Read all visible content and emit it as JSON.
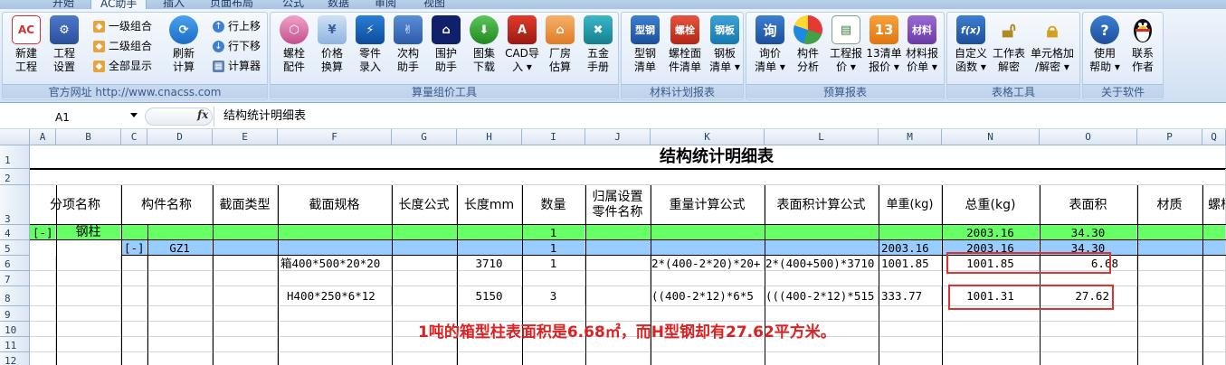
{
  "ribbon_tabs": [
    "开始",
    "AC助手",
    "插入",
    "页面布局",
    "公式",
    "数据",
    "审阅",
    "视图"
  ],
  "active_tab": "AC助手",
  "groups": {
    "site": {
      "label": "官方网址 http://www.cnacss.com",
      "new_project": "新建\n工程",
      "project_settings": "工程\n设置",
      "level1": "一级组合",
      "level2": "二级组合",
      "show_all": "全部显示",
      "refresh": "刷新\n计算",
      "row_up": "行上移",
      "row_down": "行下移",
      "calculator": "计算器"
    },
    "calc": {
      "label": "算量组价工具",
      "buttons": [
        "螺栓\n配件",
        "价格\n换算",
        "零件\n录入",
        "次构\n助手",
        "围护\n助手",
        "图集\n下载",
        "CAD导\n入 ▾",
        "厂房\n估算",
        "五金\n手册"
      ]
    },
    "material": {
      "label": "材料计划报表",
      "buttons": [
        "型钢\n清单",
        "螺栓面\n件清单",
        "钢板\n清单 ▾"
      ],
      "icon_texts": [
        "型钢",
        "螺栓",
        "钢板"
      ]
    },
    "budget": {
      "label": "预算报表",
      "buttons": [
        "询价\n清单 ▾",
        "构件\n分析",
        "工程报\n价 ▾",
        "13清单\n报价 ▾",
        "材料报\n价单 ▾"
      ],
      "icon_texts": [
        "询",
        "",
        "",
        "13",
        "材料"
      ]
    },
    "tools": {
      "label": "表格工具",
      "buttons": [
        "自定义\n函数 ▾",
        "工作表\n解密",
        "单元格加\n/解密 ▾"
      ],
      "icon_texts": [
        "f(x)",
        "",
        ""
      ]
    },
    "about": {
      "label": "关于软件",
      "buttons": [
        "使用\n帮助 ▾",
        "联系\n作者"
      ],
      "icon_texts": [
        "?",
        ""
      ]
    }
  },
  "formula_bar": {
    "name_box": "A1",
    "fx": "fx",
    "content": "结构统计明细表"
  },
  "columns": [
    "A",
    "B",
    "C",
    "D",
    "E",
    "F",
    "G",
    "H",
    "I",
    "J",
    "K",
    "L",
    "M",
    "N",
    "O",
    "P",
    "Q"
  ],
  "rows": [
    "1",
    "2",
    "3",
    "4",
    "5",
    "6",
    "7",
    "8",
    "9",
    "10",
    "11",
    "12"
  ],
  "sheet": {
    "title": "结构统计明细表",
    "headers": {
      "item_name": "分项名称",
      "member_name": "构件名称",
      "section_type": "截面类型",
      "section_spec": "截面规格",
      "length_formula": "长度公式",
      "length_mm": "长度mm",
      "quantity": "数量",
      "part_name": "归属设置\n零件名称",
      "weight_formula": "重量计算公式",
      "area_formula": "表面积计算公式",
      "unit_weight": "单重(kg)",
      "total_weight": "总重(kg)",
      "surface_area": "表面积",
      "material": "材质",
      "bolt": "螺栓"
    },
    "row4": {
      "collapse": "[-]",
      "item": "钢柱",
      "quantity": "1",
      "total_weight": "2003.16",
      "surface_area": "34.30"
    },
    "row5": {
      "collapse": "[-]",
      "member": "GZ1",
      "quantity": "1",
      "unit_weight": "2003.16",
      "total_weight": "2003.16",
      "surface_area": "34.30"
    },
    "row6": {
      "spec": "箱400*500*20*20",
      "length": "3710",
      "quantity": "1",
      "weight_formula": "2*(400-2*20)*20+",
      "area_formula": "2*(400+500)*3710",
      "unit_weight": "1001.85",
      "total_weight": "1001.85",
      "surface_area": "6.68"
    },
    "row8": {
      "spec": "H400*250*6*12",
      "length": "5150",
      "quantity": "3",
      "weight_formula": "((400-2*12)*6*5",
      "area_formula": "(((400-2*12)*515",
      "unit_weight": "333.77",
      "total_weight": "1001.31",
      "surface_area": "27.62"
    }
  },
  "annotation": "1吨的箱型柱表面积是6.68㎡，而H型钢却有27.62平方米。",
  "colors": {
    "row4_fill": "#66ff66",
    "row5_fill": "#99ccff",
    "annotation_red": "#e02020"
  }
}
